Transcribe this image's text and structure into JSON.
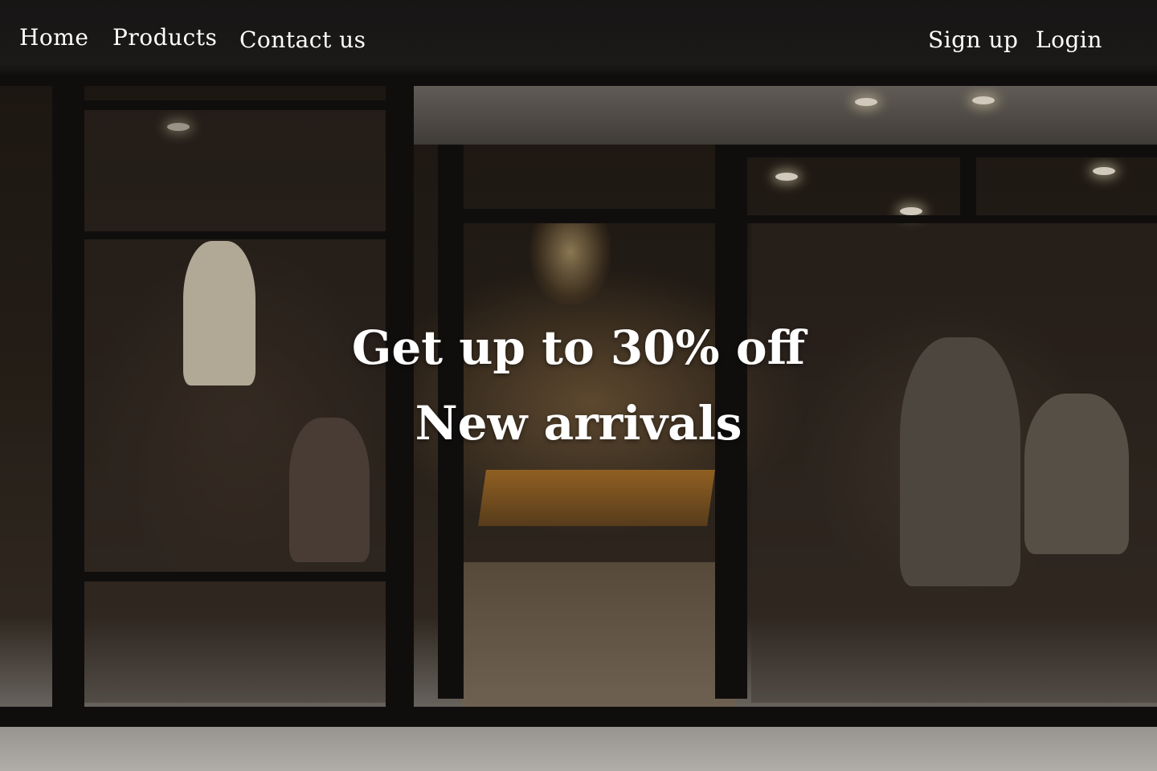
{
  "nav": {
    "left_links": [
      {
        "label": "Home"
      },
      {
        "label": "Products"
      },
      {
        "label": "Contact us"
      }
    ],
    "right_links": [
      {
        "label": "Sign up"
      },
      {
        "label": "Login"
      }
    ]
  },
  "hero": {
    "headline_line1": "Get up to 30% off",
    "headline_line2": "New arrivals"
  },
  "colors": {
    "text": "#ffffff"
  }
}
